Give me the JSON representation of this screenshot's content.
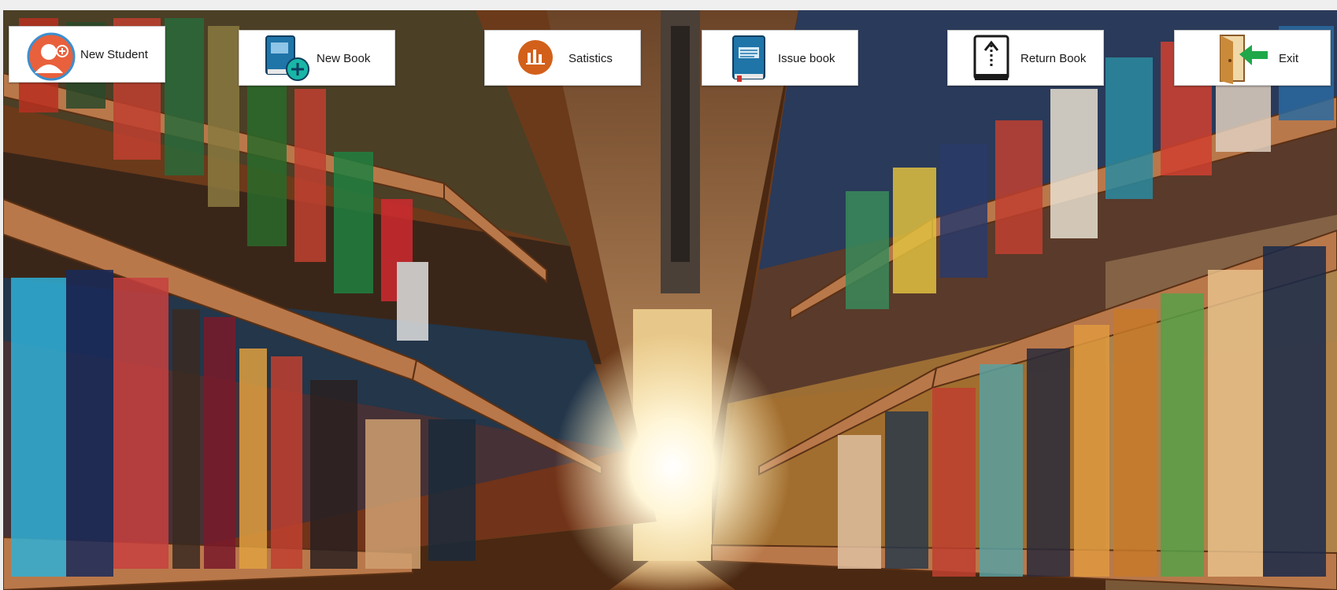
{
  "toolbar": {
    "buttons": [
      {
        "id": "new-student",
        "label": "New Student",
        "icon": "student-add-icon"
      },
      {
        "id": "new-book",
        "label": "New Book",
        "icon": "book-add-icon"
      },
      {
        "id": "statistics",
        "label": "Satistics",
        "icon": "statistics-icon"
      },
      {
        "id": "issue-book",
        "label": "Issue book",
        "icon": "issue-book-icon"
      },
      {
        "id": "return-book",
        "label": "Return Book",
        "icon": "return-book-icon"
      },
      {
        "id": "exit",
        "label": "Exit",
        "icon": "exit-icon"
      }
    ]
  },
  "background": {
    "description_icon": "library-shelves-background"
  },
  "colors": {
    "button_bg": "#ffffff",
    "student_icon": "#e9603c",
    "book_icon": "#1f74a8",
    "stats_icon": "#d2601a",
    "exit_arrow": "#1fa84a",
    "exit_door": "#c98a3a"
  }
}
